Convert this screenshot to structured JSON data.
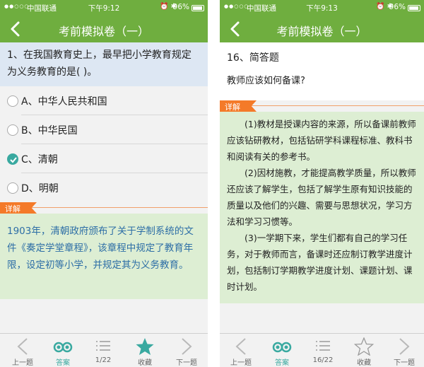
{
  "left": {
    "status": {
      "carrier": "中国联通",
      "time": "下午9:12",
      "battery": "96%"
    },
    "nav": {
      "title": "考前模拟卷（一）"
    },
    "question": {
      "text": "1、在我国教育史上，最早把小学教育规定为义务教育的是(    )。"
    },
    "options": [
      {
        "label": "A、中华人民共和国",
        "selected": false
      },
      {
        "label": "B、中华民国",
        "selected": false
      },
      {
        "label": "C、清朝",
        "selected": true
      },
      {
        "label": "D、明朝",
        "selected": false
      }
    ],
    "explain": {
      "tag": "详解",
      "text": "1903年，清朝政府颁布了关于学制系统的文件《奏定学堂章程》，该章程中规定了教育年限，设定初等小学，并规定其为义务教育。"
    },
    "toolbar": {
      "prev": "上一题",
      "answer": "答案",
      "page": "1/22",
      "fav": "收藏",
      "next": "下一题"
    }
  },
  "right": {
    "status": {
      "carrier": "中国联通",
      "time": "下午9:13",
      "battery": "96%"
    },
    "nav": {
      "title": "考前模拟卷（一）"
    },
    "question": {
      "title": "16、简答题",
      "text": "教师应该如何备课?"
    },
    "explain": {
      "tag": "详解",
      "paragraphs": [
        "(1)教材是授课内容的来源，所以备课前教师应该钻研教材，包括钻研学科课程标准、教科书和阅读有关的参考书。",
        "(2)因材施教，才能提高教学质量，所以教师还应该了解学生，包括了解学生原有知识技能的质量以及他们的兴趣、需要与思想状况，学习方法和学习习惯等。",
        "(3)一学期下来，学生们都有自己的学习任务，对于教师而言，备课时还应制订教学进度计划，包括制订学期教学进度计划、课题计划、课时计划。"
      ]
    },
    "toolbar": {
      "prev": "上一题",
      "answer": "答案",
      "page": "16/22",
      "fav": "收藏",
      "next": "下一题"
    }
  },
  "colors": {
    "brand": "#6fae3f",
    "accent": "#39a9a0",
    "tag": "#f47a29",
    "explain_bg": "#ddeed3",
    "question_bg": "#dde7f3",
    "explain_text": "#2d6ea6"
  },
  "icons": {
    "back": "chevron-left-icon",
    "prev": "chevron-left-icon",
    "answer": "eyes-icon",
    "page": "list-icon",
    "fav": "star-icon",
    "next": "chevron-right-icon"
  }
}
